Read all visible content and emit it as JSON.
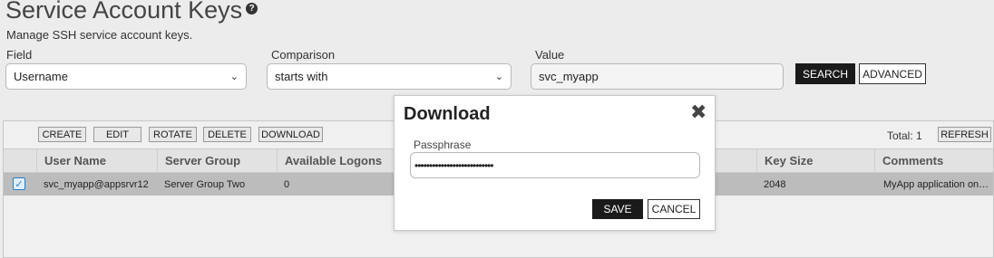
{
  "page": {
    "title": "Service Account Keys",
    "subtitle": "Manage SSH service account keys."
  },
  "filter": {
    "field_label": "Field",
    "field_value": "Username",
    "comparison_label": "Comparison",
    "comparison_value": "starts with",
    "value_label": "Value",
    "value_value": "svc_myapp",
    "search_label": "SEARCH",
    "advanced_label": "ADVANCED"
  },
  "toolbar": {
    "create": "CREATE",
    "edit": "EDIT",
    "rotate": "ROTATE",
    "delete": "DELETE",
    "download": "DOWNLOAD",
    "total": "Total: 1",
    "refresh": "REFRESH"
  },
  "table": {
    "columns": [
      "User Name",
      "Server Group",
      "Available Logons",
      "Key Size",
      "Comments"
    ],
    "rows": [
      {
        "selected": true,
        "user_name": "svc_myapp@appsrvr12",
        "server_group": "Server Group Two",
        "available_logons": "0",
        "key_size": "2048",
        "comments": "MyApp application on…"
      }
    ]
  },
  "modal": {
    "title": "Download",
    "passphrase_label": "Passphrase",
    "passphrase_value": "•••••••••••••••••••••••••••",
    "save": "SAVE",
    "cancel": "CANCEL"
  },
  "colors": {
    "accent": "#1a1a1a",
    "selected_row": "#bcbcbc",
    "checkbox": "#2d7fc4"
  }
}
